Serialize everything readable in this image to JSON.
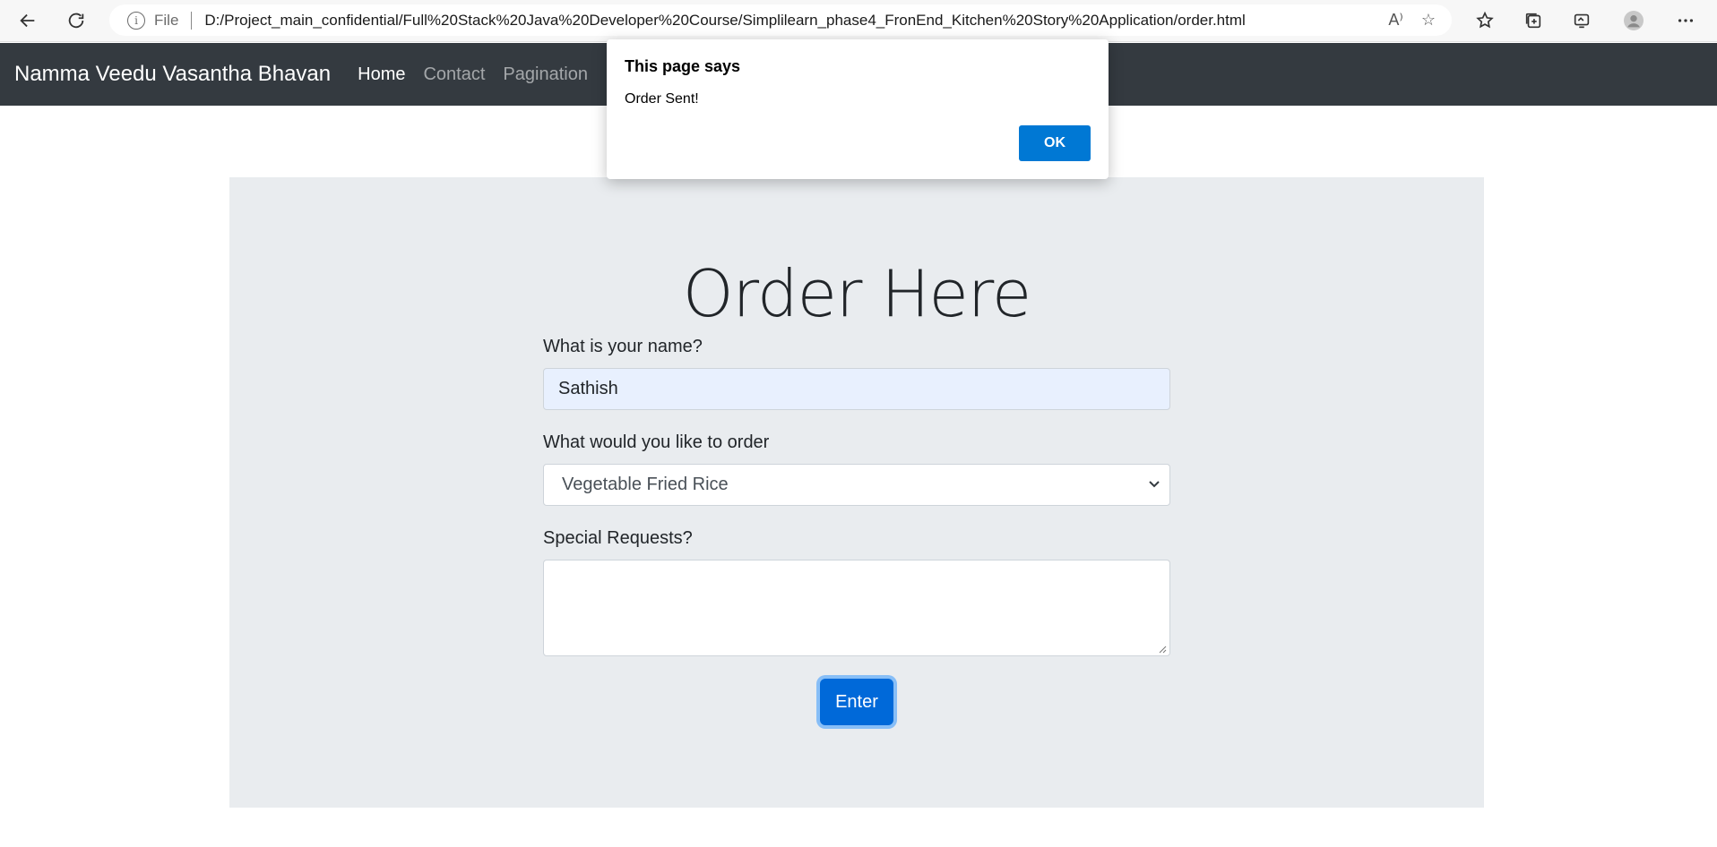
{
  "browser": {
    "file_label": "File",
    "url": "D:/Project_main_confidential/Full%20Stack%20Java%20Developer%20Course/Simplilearn_phase4_FronEnd_Kitchen%20Story%20Application/order.html",
    "read_aloud_glyph": "A⁾"
  },
  "navbar": {
    "brand": "Namma Veedu Vasantha Bhavan",
    "links": [
      {
        "label": "Home",
        "active": true
      },
      {
        "label": "Contact",
        "active": false
      },
      {
        "label": "Pagination",
        "active": false
      }
    ]
  },
  "main": {
    "title": "Order Here",
    "name_label": "What is your name?",
    "name_value": "Sathish",
    "order_label": "What would you like to order",
    "order_selected": "Vegetable Fried Rice",
    "requests_label": "Special Requests?",
    "requests_value": "",
    "submit_label": "Enter"
  },
  "dialog": {
    "title": "This page says",
    "message": "Order Sent!",
    "ok_label": "OK"
  },
  "colors": {
    "navbar_bg": "#343a40",
    "jumbotron_bg": "#e9ecef",
    "primary": "#0069d9",
    "dialog_ok": "#0078d4"
  }
}
